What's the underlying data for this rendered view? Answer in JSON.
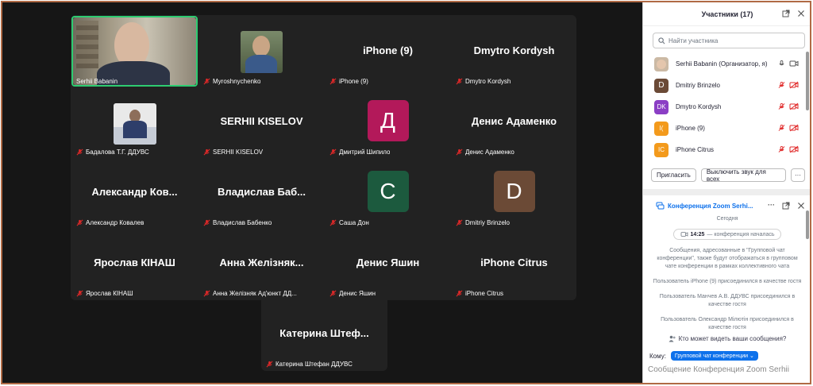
{
  "tiles": [
    {
      "label": "Serhii Babanin"
    },
    {
      "label": "Myroshnychenko"
    },
    {
      "name": "iPhone (9)",
      "label": "iPhone (9)"
    },
    {
      "name": "Dmytro Kordysh",
      "label": "Dmytro Kordysh"
    },
    {
      "label": "Бадалова Т.Г. ДДУВС"
    },
    {
      "name": "SERHII KISELOV",
      "label": "SERHII KISELOV"
    },
    {
      "letter": "Д",
      "label": "Дмитрий Шипило",
      "color": "#b3195a"
    },
    {
      "name": "Денис Адаменко",
      "label": "Денис Адаменко"
    },
    {
      "name": "Александр Ков...",
      "label": "Александр Ковалев"
    },
    {
      "name": "Владислав Баб...",
      "label": "Владислав Бабенко"
    },
    {
      "letter": "C",
      "label": "Саша Дон",
      "color": "#1c5a3e"
    },
    {
      "letter": "D",
      "label": "Dmitriy Brinzelo",
      "color": "#6b4a36"
    },
    {
      "name": "Ярослав КІНАШ",
      "label": "Ярослав КІНАШ"
    },
    {
      "name": "Анна Желізняк...",
      "label": "Анна Желізняк Ад'юнкт ДД..."
    },
    {
      "name": "Денис Яшин",
      "label": "Денис Яшин"
    },
    {
      "name": "iPhone Citrus",
      "label": "iPhone Citrus"
    },
    {
      "name": "Катерина Штеф...",
      "label": "Катерина Штефан ДДУВС"
    }
  ],
  "participants": {
    "title": "Участники (17)",
    "search_placeholder": "Найти участника",
    "items": [
      {
        "name": "Serhii Babanin (Организатор, я)"
      },
      {
        "initials": "D",
        "name": "Dmitriy Brinzelo",
        "color": "#6b4a36"
      },
      {
        "initials": "DK",
        "name": "Dmytro Kordysh",
        "color": "#8b3fc5"
      },
      {
        "initials": "I(",
        "name": "iPhone (9)",
        "color": "#f39a1c"
      },
      {
        "initials": "IC",
        "name": "iPhone Citrus",
        "color": "#f39a1c"
      }
    ],
    "invite_label": "Пригласить",
    "mute_all_label": "Выключить звук для всех",
    "more_label": "···"
  },
  "chat": {
    "title": "Конференция Zoom Serhi...",
    "today": "Сегодня",
    "start_time": "14:25",
    "start_text": "— конференция началась",
    "messages": [
      "Сообщения, адресованные в \"Групповой чат конференции\", также будут отображаться в групповом чате конференции в рамках коллективного чата",
      "Пользователь iPhone (9) присоединился в качестве гостя",
      "Пользователь Манчев А.В. ДДУВС присоединился в качестве гостя",
      "Пользователь Олександр Мілютін присоединился в качестве гостя"
    ],
    "who_can_see": "Кто может видеть ваши сообщения?",
    "to_label": "Кому:",
    "to_value": "Групповой чат конференции",
    "composer_placeholder": "Сообщение Конференция Zoom Serhii"
  },
  "colors": {
    "accent": "#0e71eb",
    "muted_icon": "#e02828",
    "active_speaker": "#2ecc71"
  }
}
